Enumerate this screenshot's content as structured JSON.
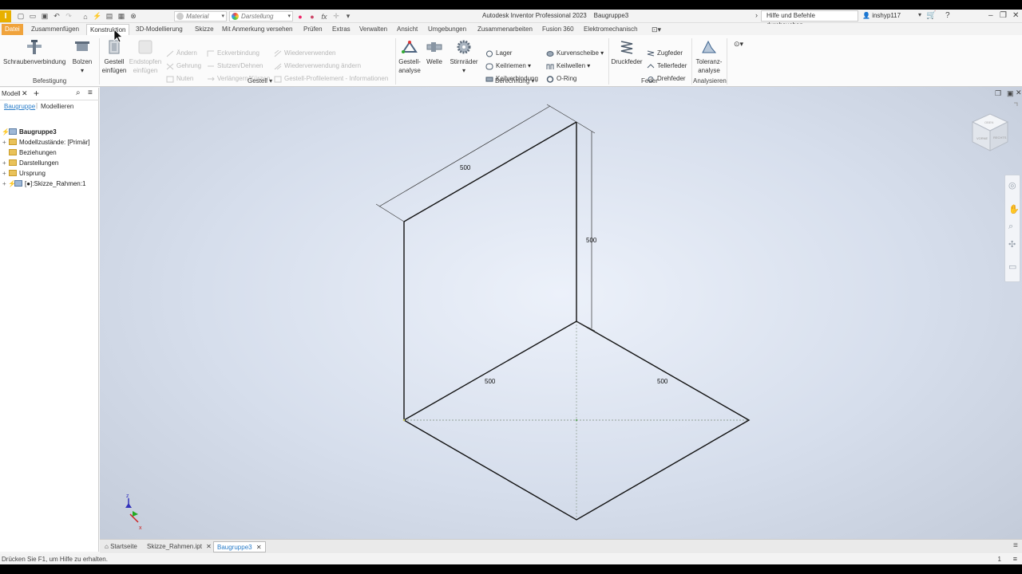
{
  "window": {
    "app_title": "Autodesk Inventor Professional 2023",
    "document_name": "Baugruppe3",
    "help_search": "Hilfe und Befehle durchsuchen...",
    "user": "inshyp117"
  },
  "quick_access": {
    "material": "Material",
    "appearance": "Darstellung"
  },
  "menu_tabs": [
    "Datei",
    "Zusammenfügen",
    "Konstruktion",
    "3D-Modellierung",
    "Skizze",
    "Mit Anmerkung versehen",
    "Prüfen",
    "Extras",
    "Verwalten",
    "Ansicht",
    "Umgebungen",
    "Zusammenarbeiten",
    "Fusion 360",
    "Elektromechanisch"
  ],
  "active_tab": "Konstruktion",
  "ribbon": {
    "befestigung": {
      "label": "Befestigung",
      "schraube": "Schraubenverbindung",
      "bolzen": "Bolzen"
    },
    "gestell": {
      "label": "Gestell",
      "einfuegen_1": "Gestell",
      "einfuegen_2": "einfügen",
      "endstopfen_1": "Endstopfen",
      "endstopfen_2": "einfügen",
      "aendern": "Ändern",
      "gehrung": "Gehrung",
      "nuten": "Nuten",
      "eckverbindung": "Eckverbindung",
      "stutzen": "Stutzen/Dehnen",
      "verlaengern": "Verlängern/Kürzen",
      "wiederverwenden": "Wiederverwenden",
      "wiederverwendung_aendern": "Wiederverwendung ändern",
      "profilelement": "Gestell-Profilelement - Informationen"
    },
    "berechnung": {
      "label": "Berechnung",
      "gestellanalyse_1": "Gestell-",
      "gestellanalyse_2": "analyse",
      "welle": "Welle",
      "stirnraeder": "Stirnräder",
      "lager": "Lager",
      "keilriemen": "Keilriemen",
      "keilverbindung": "Keilverbindung",
      "kurvenscheibe": "Kurvenscheibe",
      "keilwellen": "Keilwellen",
      "oring": "O-Ring"
    },
    "feder": {
      "label": "Feder",
      "druckfeder": "Druckfeder",
      "zugfeder": "Zugfeder",
      "tellerfeder": "Tellerfeder",
      "drehfeder": "Drehfeder"
    },
    "analysieren": {
      "label": "Analysieren",
      "toleranz_1": "Toleranz-",
      "toleranz_2": "analyse"
    }
  },
  "browser": {
    "title": "Modell",
    "tab_assembly": "Baugruppe",
    "tab_model": "Modellieren",
    "tree": [
      {
        "label": "Baugruppe3",
        "bold": true
      },
      {
        "label": "Modellzustände: [Primär]"
      },
      {
        "label": "Beziehungen"
      },
      {
        "label": "Darstellungen"
      },
      {
        "label": "Ursprung"
      },
      {
        "label": "[●]:Skizze_Rahmen:1"
      }
    ]
  },
  "viewport": {
    "dimensions": [
      "500",
      "500",
      "500",
      "500"
    ],
    "viewcube_faces": [
      "VORNE",
      "RECHTS",
      "OBEN"
    ]
  },
  "doc_tabs": [
    "Startseite",
    "Skizze_Rahmen.ipt",
    "Baugruppe3"
  ],
  "active_doc_tab": "Baugruppe3",
  "status": "Drücken Sie F1, um Hilfe zu erhalten.",
  "status_right": "1"
}
